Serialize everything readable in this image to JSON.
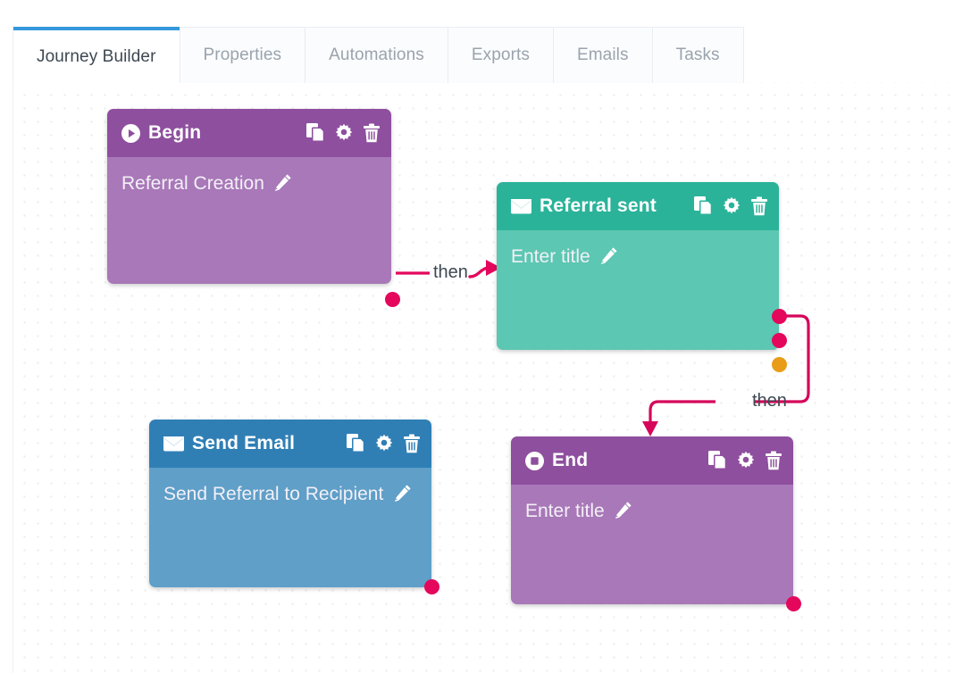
{
  "tabs": [
    {
      "label": "Journey Builder",
      "active": true
    },
    {
      "label": "Properties",
      "active": false
    },
    {
      "label": "Automations",
      "active": false
    },
    {
      "label": "Exports",
      "active": false
    },
    {
      "label": "Emails",
      "active": false
    },
    {
      "label": "Tasks",
      "active": false
    }
  ],
  "colors": {
    "accent_tab": "#3498db",
    "connector": "#e4075c",
    "port_crimson": "#e4075c",
    "port_orange": "#e89c17",
    "purple_header": "#8e4f9e",
    "purple_body": "#a878b8",
    "teal_header": "#2bb39a",
    "teal_body": "#5cc7b2",
    "blue_header": "#2f7fb5",
    "blue_body": "#5f9fc8"
  },
  "nodes": [
    {
      "id": "begin",
      "title": "Begin",
      "subtitle": "Referral Creation",
      "type_icon": "play-icon",
      "actions": [
        "copy-icon",
        "gear-icon",
        "trash-icon"
      ]
    },
    {
      "id": "referral-sent",
      "title": "Referral sent",
      "subtitle": "Enter title",
      "type_icon": "envelope-icon",
      "actions": [
        "copy-icon",
        "gear-icon",
        "trash-icon"
      ]
    },
    {
      "id": "send-email",
      "title": "Send Email",
      "subtitle": "Send Referral to Recipient",
      "type_icon": "envelope-icon",
      "actions": [
        "copy-icon",
        "gear-icon",
        "trash-icon"
      ]
    },
    {
      "id": "end",
      "title": "End",
      "subtitle": "Enter title",
      "type_icon": "stop-icon",
      "actions": [
        "copy-icon",
        "gear-icon",
        "trash-icon"
      ]
    }
  ],
  "edges": [
    {
      "id": "edge-begin-to-referral-sent",
      "label": "then"
    },
    {
      "id": "edge-referral-sent-to-end",
      "label": "then"
    }
  ]
}
